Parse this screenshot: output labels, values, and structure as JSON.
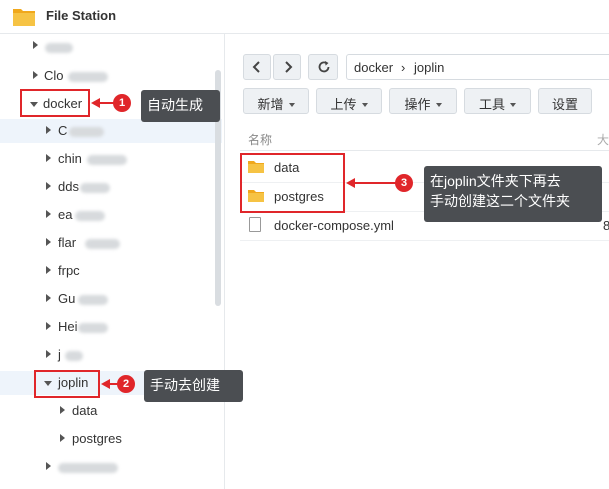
{
  "app": {
    "title": "File Station",
    "icon": "folder-icon"
  },
  "sidebar": {
    "items": [
      {
        "label": "",
        "depth": 1,
        "expanded": false
      },
      {
        "label": "Clo",
        "depth": 1,
        "expanded": false
      },
      {
        "label": "docker",
        "depth": 1,
        "expanded": true
      },
      {
        "label": "C",
        "depth": 2,
        "expanded": false
      },
      {
        "label": "chin",
        "depth": 2,
        "expanded": false
      },
      {
        "label": "dds",
        "depth": 2,
        "expanded": false
      },
      {
        "label": "ea",
        "depth": 2,
        "expanded": false
      },
      {
        "label": "flar",
        "depth": 2,
        "expanded": false
      },
      {
        "label": "frpc",
        "depth": 2,
        "expanded": false
      },
      {
        "label": "Gu",
        "depth": 2,
        "expanded": false
      },
      {
        "label": "Hei",
        "depth": 2,
        "expanded": false
      },
      {
        "label": "j",
        "depth": 2,
        "expanded": false
      },
      {
        "label": "joplin",
        "depth": 2,
        "expanded": true
      },
      {
        "label": "data",
        "depth": 3,
        "expanded": false
      },
      {
        "label": "postgres",
        "depth": 3,
        "expanded": false
      },
      {
        "label": "",
        "depth": 2,
        "expanded": false
      }
    ],
    "blurred_suffixes": [
      "rore",
      "ubfinder",
      "jo",
      "nage",
      "er",
      "mole",
      "l",
      "ett"
    ]
  },
  "toolbar": {
    "back_icon": "chevron-left-icon",
    "forward_icon": "chevron-right-icon",
    "refresh_icon": "refresh-icon",
    "path": {
      "segment1": "docker",
      "separator": "›",
      "segment2": "joplin"
    },
    "buttons": {
      "new": "新增",
      "upload": "上传",
      "action": "操作",
      "tools": "工具",
      "settings": "设置"
    }
  },
  "list": {
    "header": {
      "name": "名称",
      "extra": "大"
    },
    "rows": [
      {
        "name": "data",
        "type": "folder"
      },
      {
        "name": "postgres",
        "type": "folder"
      },
      {
        "name": "docker-compose.yml",
        "type": "file",
        "extra": "8"
      }
    ]
  },
  "annotations": {
    "a1": {
      "number": "1",
      "text": "自动生成"
    },
    "a2": {
      "number": "2",
      "text": "手动去创建"
    },
    "a3": {
      "number": "3",
      "line1": "在joplin文件夹下再去",
      "line2": "手动创建这二个文件夹"
    }
  },
  "colors": {
    "accent_red": "#e0262a",
    "callout_bg": "#4b4e52",
    "folder_yellow": "#f6c344",
    "highlight_row": "#eef4fb"
  }
}
